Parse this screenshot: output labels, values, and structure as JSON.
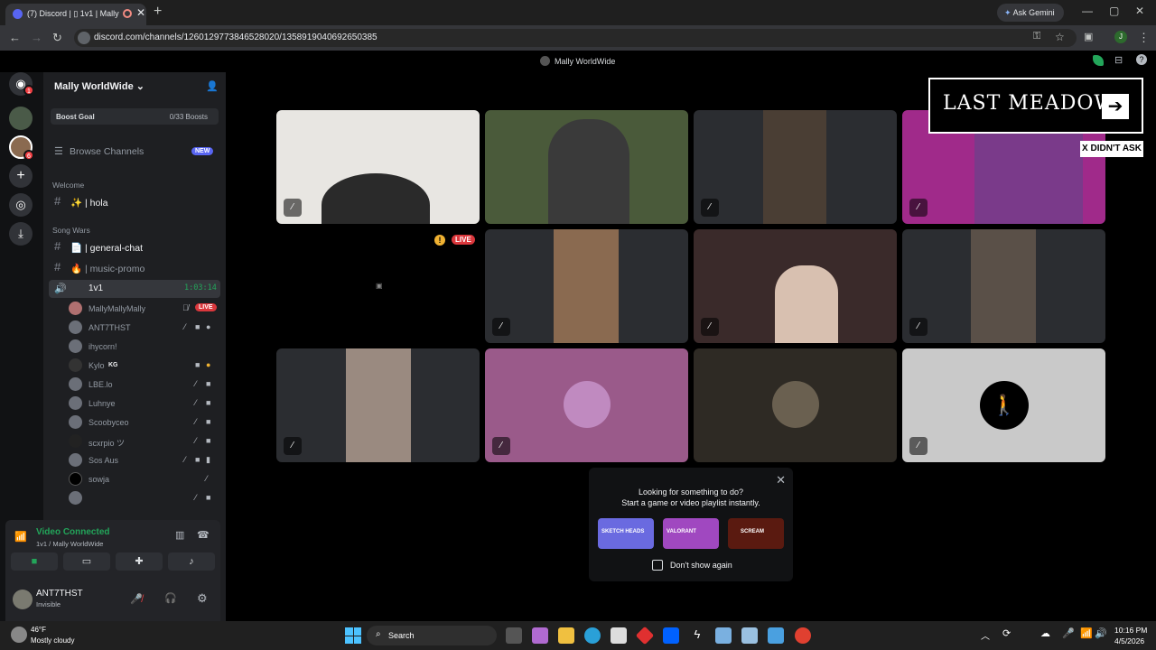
{
  "browser": {
    "tab_title": "(7) Discord | ▯ 1v1 | Mally",
    "new_tab": "+",
    "ask_gemini": "Ask Gemini",
    "url": "discord.com/channels/1260129773846528020/1358919040692650385",
    "profile_initial": "J",
    "window_controls": [
      "—",
      "▢",
      "✕"
    ]
  },
  "app": {
    "server_title": "Mally WorldWide"
  },
  "guild_bar": {
    "badges": [
      "1",
      "6"
    ]
  },
  "sidebar": {
    "server_name": "Mally WorldWide",
    "boost_label": "Boost Goal",
    "boost_value": "0/33 Boosts",
    "browse_channels": "Browse Channels",
    "new_badge": "NEW",
    "category_welcome": "Welcome",
    "channel_hola": "✨ | hola",
    "category_song_wars": "Song Wars",
    "channel_general": "📄 | general-chat",
    "channel_music": "🔥 | music-promo",
    "voice_channel": "1v1",
    "voice_timer": "1:03:14",
    "members": [
      {
        "name": "MallyMallyMally",
        "live": "LIVE"
      },
      {
        "name": "ANT7THST"
      },
      {
        "name": "ihycorn!"
      },
      {
        "name": "Kylo",
        "tag": "KG"
      },
      {
        "name": "LBE.lo"
      },
      {
        "name": "Luhnye"
      },
      {
        "name": "Scoobyceo"
      },
      {
        "name": "scxrpio ツ"
      },
      {
        "name": "Sos Aus"
      },
      {
        "name": "sowja"
      },
      {
        "name": ""
      }
    ]
  },
  "voice_panel": {
    "status": "Video Connected",
    "location": "1v1 / Mally WorldWide"
  },
  "user_panel": {
    "username": "ANT7THST",
    "status": "Invisible"
  },
  "stream": {
    "live_label": "LIVE"
  },
  "overlay": {
    "ad_title": "LAST MEADOW",
    "caption": "X DIDN'T ASK"
  },
  "activity_popup": {
    "line1": "Looking for something to do?",
    "line2": "Start a game or video playlist instantly.",
    "checkbox_label": "Don't show again",
    "cards": [
      "SKETCH HEADS",
      "VALORANT",
      "SCREAM"
    ]
  },
  "taskbar": {
    "weather_temp": "46°F",
    "weather_desc": "Mostly cloudy",
    "search_placeholder": "Search",
    "time": "10:16 PM",
    "date": "4/5/2026"
  },
  "colors": {
    "accent": "#5865f2",
    "green": "#23a55a",
    "live_red": "#da373c"
  }
}
